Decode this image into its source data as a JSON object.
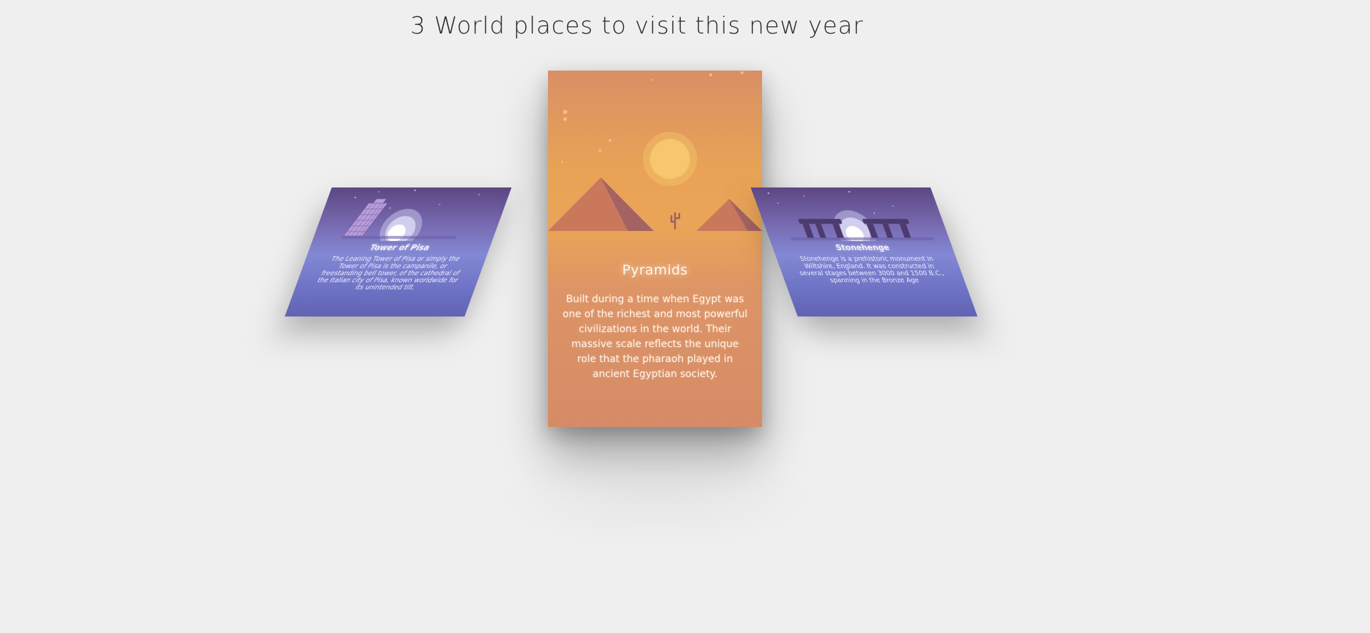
{
  "page": {
    "title": "3 World places to visit this new year"
  },
  "cards": {
    "left": {
      "name": "Tower of Pisa",
      "description": "The Leaning Tower of Pisa or simply the Tower of Pisa is the campanile, or freestanding bell tower, of the cathedral of the Italian city of Pisa, known worldwide for its unintended tilt."
    },
    "center": {
      "name": "Pyramids",
      "description": "Built during a time when Egypt was one of the richest and most powerful civilizations in the world. Their massive scale reflects the unique role that the pharaoh played in ancient Egyptian society."
    },
    "right": {
      "name": "Stonehenge",
      "description": "Stonehenge is a prehistoric monument in Wiltshire, England. It was constructed in several stages between 3000 and 1500 B.C., spanning in the Bronze Age"
    }
  },
  "icons": {
    "left": "leaning-tower-illustration",
    "center": "pyramids-illustration",
    "right": "stonehenge-illustration"
  },
  "colors": {
    "background": "#efefef",
    "center_card": "#e9a356",
    "side_card": "#8288d4",
    "sun": "#f6c76c",
    "pyramid": "#c9785c"
  }
}
